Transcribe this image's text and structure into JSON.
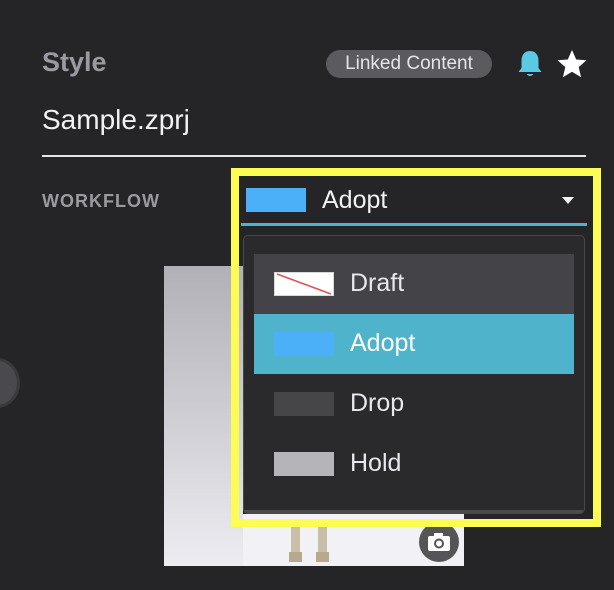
{
  "header": {
    "section_label": "Style",
    "linked_content_label": "Linked Content",
    "icons": {
      "notification": "bell-icon",
      "favorite": "star-icon"
    }
  },
  "file": {
    "name": "Sample.zprj"
  },
  "workflow": {
    "label": "WORKFLOW",
    "selected": "Adopt",
    "options": [
      {
        "label": "Draft",
        "swatch": "#ffffff",
        "marked": true
      },
      {
        "label": "Adopt",
        "swatch": "#4bb0f7",
        "selected": true
      },
      {
        "label": "Drop",
        "swatch": "#464649"
      },
      {
        "label": "Hold",
        "swatch": "#b5b5b9"
      }
    ]
  },
  "colors": {
    "background": "#252528",
    "accent": "#4fb3cc",
    "highlight_frame": "#fdfc53",
    "bell": "#5bc8e4"
  },
  "thumbnail": {
    "icons": {
      "capture": "camera-icon"
    }
  }
}
